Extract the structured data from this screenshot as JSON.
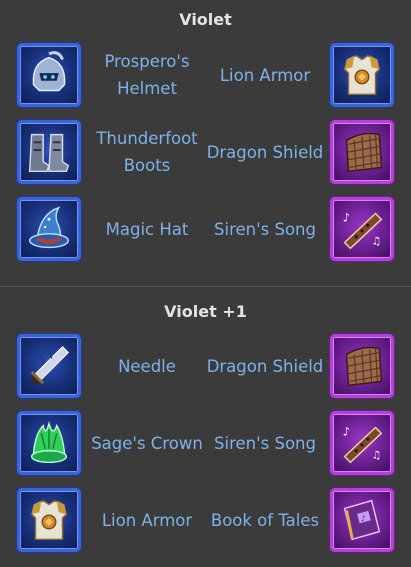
{
  "sections": [
    {
      "title": "Violet",
      "rows": [
        {
          "left": {
            "label": "Prospero's Helmet",
            "icon": "helmet-icon",
            "rarity": "blue"
          },
          "right": {
            "label": "Lion Armor",
            "icon": "armor-icon",
            "rarity": "blue"
          }
        },
        {
          "left": {
            "label": "Thunderfoot Boots",
            "icon": "boots-icon",
            "rarity": "blue"
          },
          "right": {
            "label": "Dragon Shield",
            "icon": "shield-icon",
            "rarity": "purple"
          }
        },
        {
          "left": {
            "label": "Magic Hat",
            "icon": "wizard-hat-icon",
            "rarity": "blue"
          },
          "right": {
            "label": "Siren's Song",
            "icon": "flute-icon",
            "rarity": "purple"
          }
        }
      ]
    },
    {
      "title": "Violet +1",
      "rows": [
        {
          "left": {
            "label": "Needle",
            "icon": "dagger-icon",
            "rarity": "blue"
          },
          "right": {
            "label": "Dragon Shield",
            "icon": "shield-icon",
            "rarity": "purple"
          }
        },
        {
          "left": {
            "label": "Sage's Crown",
            "icon": "leaf-crown-icon",
            "rarity": "blue"
          },
          "right": {
            "label": "Siren's Song",
            "icon": "flute-icon",
            "rarity": "purple"
          }
        },
        {
          "left": {
            "label": "Lion Armor",
            "icon": "armor-icon",
            "rarity": "blue"
          },
          "right": {
            "label": "Book of Tales",
            "icon": "book-icon",
            "rarity": "purple"
          }
        }
      ]
    }
  ],
  "colors": {
    "background": "#3b3b3b",
    "label": "#7fb1ea",
    "blue_frame": "#3d64d6",
    "purple_frame": "#b242d8"
  }
}
